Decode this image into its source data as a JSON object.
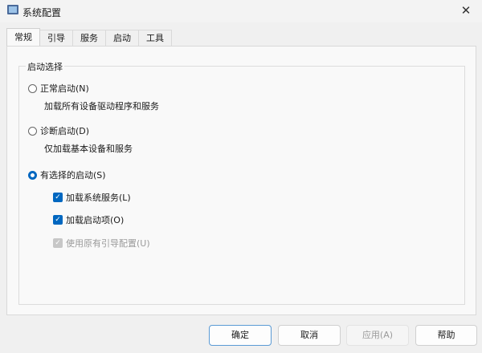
{
  "window": {
    "title": "系统配置",
    "close_icon": "close-icon"
  },
  "tabs": [
    {
      "label": "常规",
      "active": true
    },
    {
      "label": "引导"
    },
    {
      "label": "服务"
    },
    {
      "label": "启动"
    },
    {
      "label": "工具"
    }
  ],
  "group": {
    "title": "启动选择",
    "normal": {
      "label": "正常启动(N)",
      "desc": "加载所有设备驱动程序和服务",
      "selected": false
    },
    "diagnostic": {
      "label": "诊断启动(D)",
      "desc": "仅加载基本设备和服务",
      "selected": false
    },
    "selective": {
      "label": "有选择的启动(S)",
      "selected": true,
      "options": [
        {
          "label": "加载系统服务(L)",
          "checked": true,
          "enabled": true
        },
        {
          "label": "加载启动项(O)",
          "checked": true,
          "enabled": true
        },
        {
          "label": "使用原有引导配置(U)",
          "checked": true,
          "enabled": false
        }
      ]
    }
  },
  "buttons": {
    "ok": "确定",
    "cancel": "取消",
    "apply": "应用(A)",
    "help": "帮助"
  },
  "colors": {
    "accent": "#0067c0"
  }
}
